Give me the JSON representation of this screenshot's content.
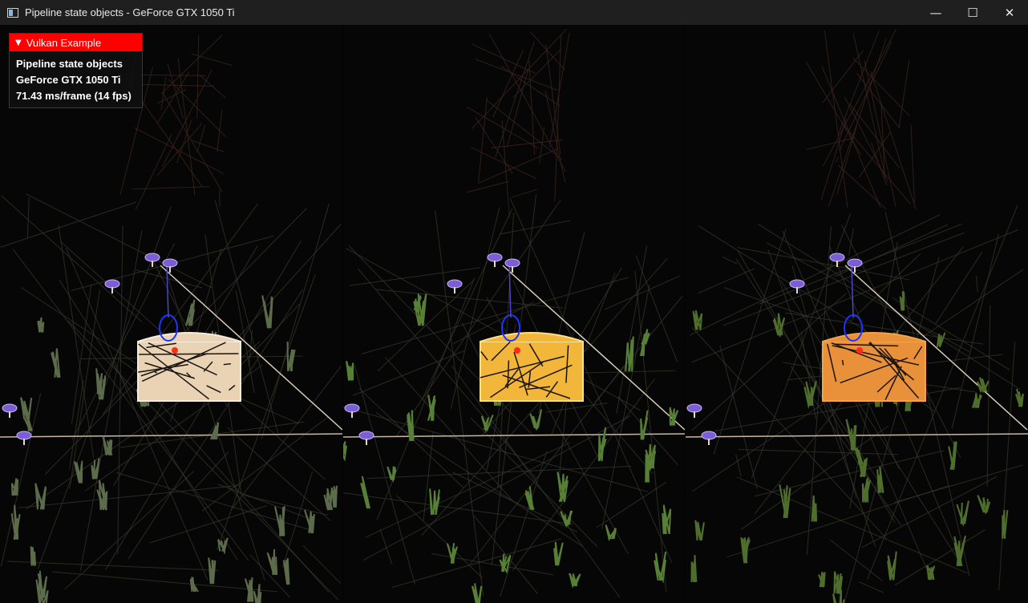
{
  "window": {
    "title": "Pipeline state objects - GeForce GTX 1050 Ti",
    "app_icon": "console-window-icon",
    "controls": {
      "minimize": "—",
      "maximize": "☐",
      "close": "✕"
    }
  },
  "overlay": {
    "header": "Vulkan Example",
    "caret": "▼",
    "lines": [
      "Pipeline state objects",
      "GeForce GTX 1050 Ti",
      "71.43 ms/frame (14 fps)"
    ]
  },
  "scene": {
    "panes": [
      {
        "name": "phong",
        "chest_color": "#e9d3b4",
        "chest_edge": "#f7ecdd",
        "grass": "#5c6b4a"
      },
      {
        "name": "toon",
        "chest_color": "#f2b63a",
        "chest_edge": "#ffe08a",
        "grass": "#577f35"
      },
      {
        "name": "wireframe",
        "chest_color": "#e9903a",
        "chest_edge": "#f5a347",
        "grass": "#4f6e2c"
      }
    ],
    "colors": {
      "background": "#060606",
      "terrain_line": "#3a3a2e",
      "tree_line": "#3b241d",
      "mushroom": "#7b5dd4",
      "blue_marker": "#1c35ff",
      "red_marker": "#ff2a1a"
    }
  }
}
